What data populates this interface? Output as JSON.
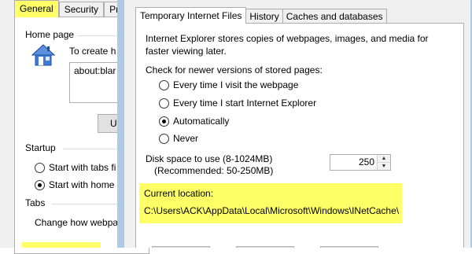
{
  "background_window": {
    "tabs": [
      "General",
      "Security",
      "Priva"
    ],
    "home_page": {
      "group_label": "Home page",
      "instruction": "To create h",
      "url_value": "about:blar",
      "button_label": "U"
    },
    "startup": {
      "group_label": "Startup",
      "options": [
        {
          "label": "Start with tabs fi",
          "selected": false
        },
        {
          "label": "Start with home",
          "selected": true
        }
      ]
    },
    "tabs_group": {
      "group_label": "Tabs",
      "text": "Change how webpa"
    },
    "highlight_color": "#ffff66"
  },
  "dialog": {
    "tabs": [
      "Temporary Internet Files",
      "History",
      "Caches and databases"
    ],
    "selected_tab": "Temporary Internet Files",
    "description": "Internet Explorer stores copies of webpages, images, and media for faster viewing later.",
    "check_label": "Check for newer versions of stored pages:",
    "options": [
      {
        "label": "Every time I visit the webpage",
        "selected": false
      },
      {
        "label": "Every time I start Internet Explorer",
        "selected": false
      },
      {
        "label": "Automatically",
        "selected": true
      },
      {
        "label": "Never",
        "selected": false
      }
    ],
    "disk_space_label": "Disk space to use (8-1024MB)",
    "disk_space_recommended": "(Recommended: 50-250MB)",
    "disk_space_value": "250",
    "current_location_label": "Current location:",
    "current_location_path": "C:\\Users\\ACK\\AppData\\Local\\Microsoft\\Windows\\INetCache\\",
    "highlight_color": "#ffff66",
    "frame_color": "#aecbe6"
  }
}
